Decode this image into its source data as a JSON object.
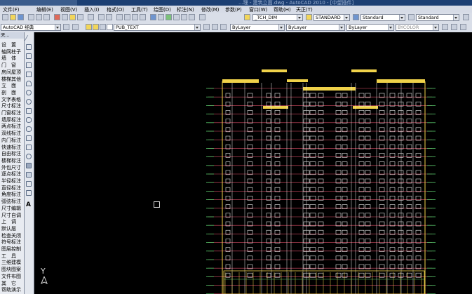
{
  "window": {
    "title": "...理 - 建筑立面.dwg - AutoCAD 2010 - [中望插件]"
  },
  "menu": [
    "文件(F)",
    "编辑(E)",
    "视图(V)",
    "插入(I)",
    "格式(O)",
    "工具(T)",
    "绘图(D)",
    "标注(N)",
    "修改(M)",
    "参数(P)",
    "窗口(W)",
    "帮助(H)",
    "天正(T)"
  ],
  "toolbar": {
    "dimstyle": "_TCH_DIM",
    "textstyle": "STANDARD",
    "tablestyle": "Standard",
    "mleaderstyle": "Standard"
  },
  "properties": {
    "workspace": "AutoCAD 经典",
    "layer": "PUB_TEXT",
    "color": "ByLayer",
    "linetype": "ByLayer",
    "lineweight": "ByLayer",
    "plotstyle": "BYCOLOR"
  },
  "palette": {
    "header": "天...",
    "items": [
      "设　置",
      "轴网柱子",
      "墙　体",
      "门　窗",
      "房间屋顶",
      "楼梯其他",
      "立　面",
      "剖　面",
      "文字表格",
      "尺寸标注",
      "门窗标注",
      "墙厚标注",
      "两点标注",
      "双线标注",
      "内门标注",
      "快速标注",
      "自由标注",
      "楼梯标注",
      "外包尺寸",
      "逐点标注",
      "半径标注",
      "直径标注",
      "角度标注",
      "弧弦标注",
      "尺寸编辑",
      "尺寸自调",
      "上　调",
      "默认层",
      "检查关闭",
      "符号标注",
      "图层控制",
      "工　具",
      "三维建模",
      "图块图案",
      "文件布图",
      "其　它",
      "帮助演示"
    ]
  },
  "canvas": {
    "ucs_label": "Y",
    "background": "#000000"
  },
  "colors": {
    "wall": "#f0d24a",
    "grid": "#e0506a",
    "window": "#e8e8e8",
    "level": "#56c86a"
  }
}
